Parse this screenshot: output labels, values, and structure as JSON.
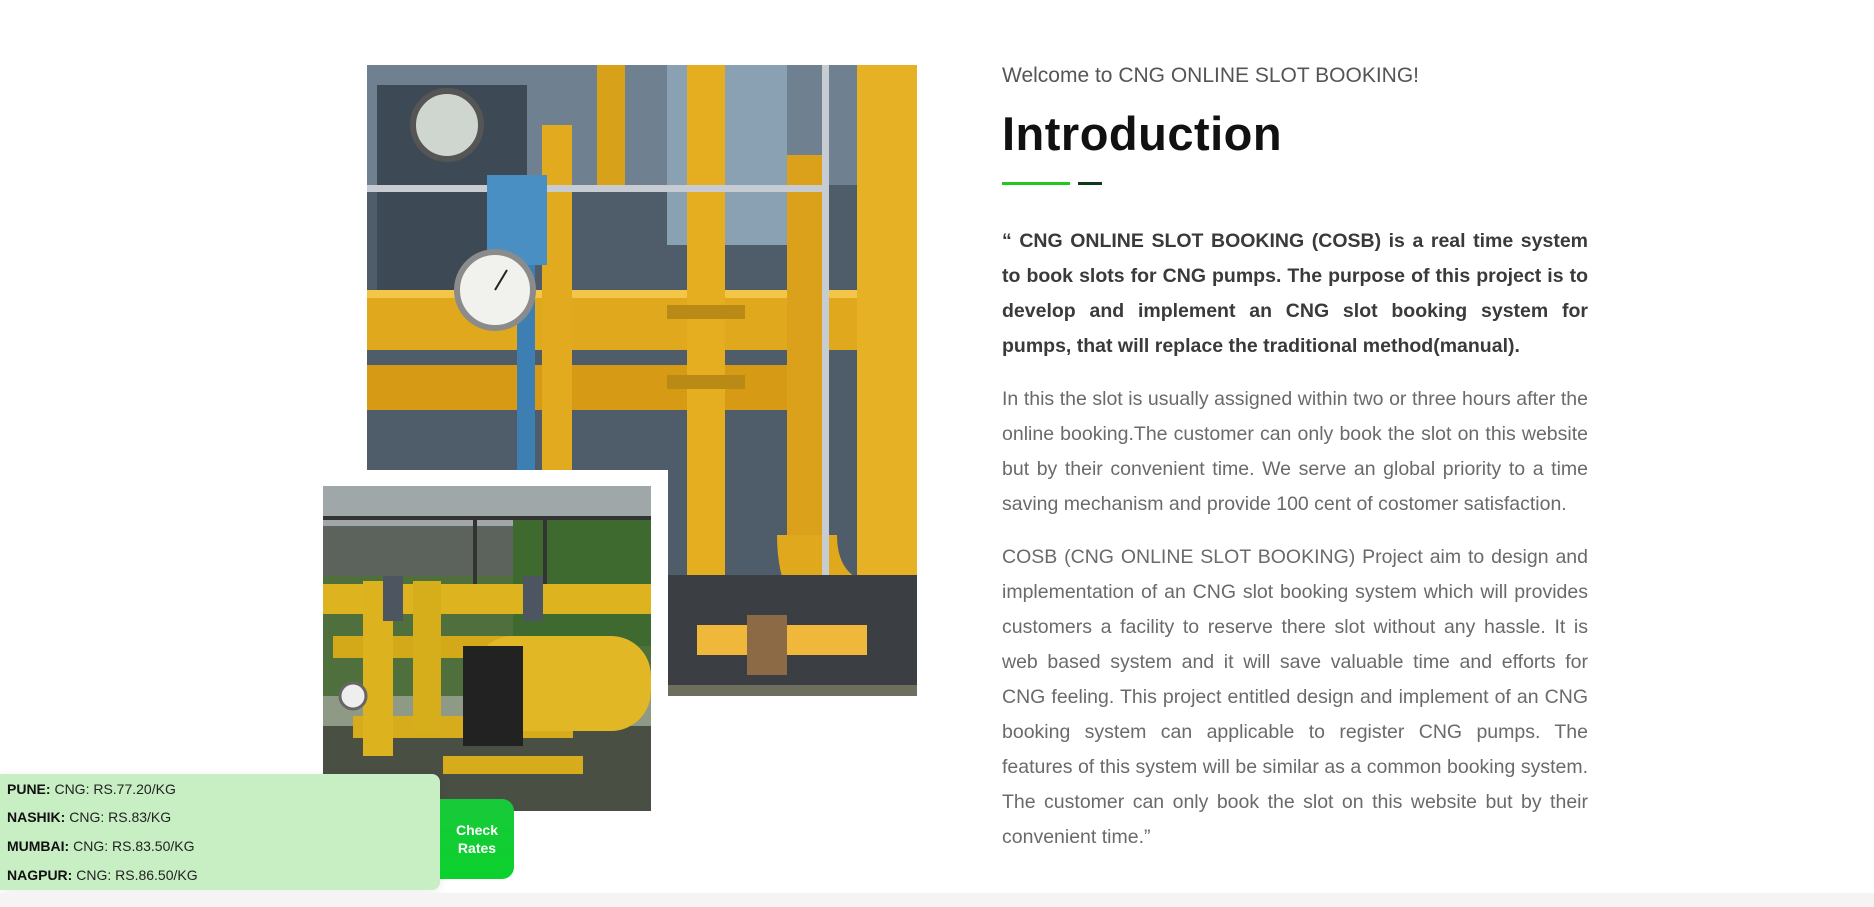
{
  "intro": {
    "welcome": "Welcome to CNG ONLINE SLOT BOOKING!",
    "title": "Introduction",
    "lead": "“ CNG ONLINE SLOT BOOKING (COSB) is a real time system to book slots for CNG pumps. The purpose of this project is to develop and implement an CNG slot booking system for pumps, that will replace the traditional method(manual).",
    "para1": "In this the slot is usually assigned within two or three hours after the online booking.The customer can only book the slot on this website but by their convenient time. We serve an global priority to a time saving mechanism and provide 100 cent of costomer satisfaction.",
    "para2": "COSB (CNG ONLINE SLOT BOOKING) Project aim to design and implementation of an CNG slot booking system which will provides customers a facility to reserve there slot without any hassle. It is web based system and it will save valuable time and efforts for CNG feeling. This project entitled design and implement of an CNG booking system can applicable to register CNG pumps. The features of this system will be similar as a common booking system. The customer can only book the slot on this website but by their convenient time.”"
  },
  "rates": {
    "items": [
      {
        "city": "PUNE:",
        "price": "CNG: RS.77.20/KG"
      },
      {
        "city": "NASHIK:",
        "price": "CNG: RS.83/KG"
      },
      {
        "city": "MUMBAI:",
        "price": "CNG: RS.83.50/KG"
      },
      {
        "city": "NAGPUR:",
        "price": "CNG: RS.86.50/KG"
      }
    ],
    "button_label": "Check Rates"
  },
  "colors": {
    "accent_green": "#22c81f",
    "accent_dark": "#0d3b1a",
    "rates_bg": "#c8efc3",
    "button_green": "#0bd12c"
  }
}
